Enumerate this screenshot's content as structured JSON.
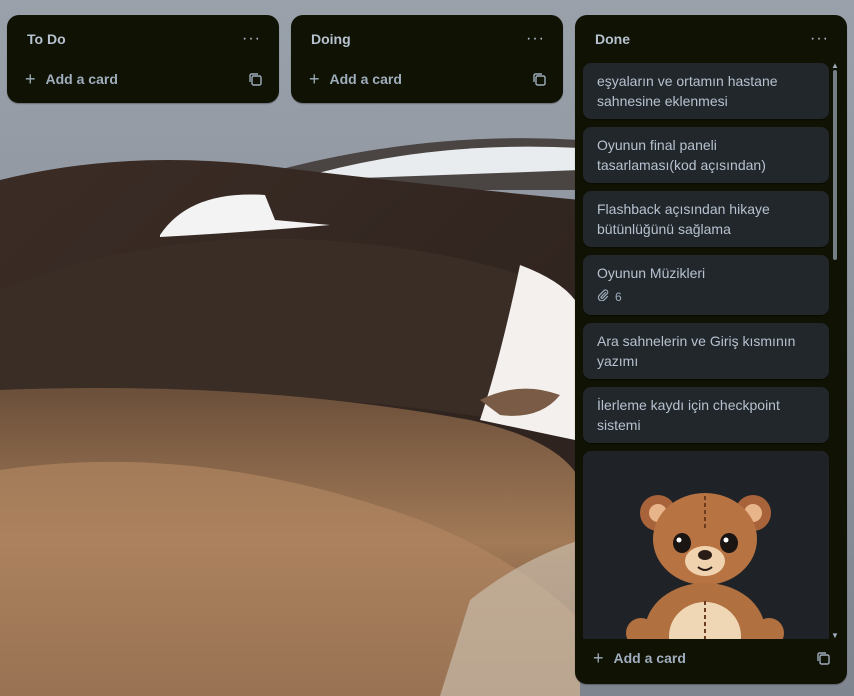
{
  "lists": [
    {
      "title": "To Do",
      "menu": "···",
      "add_label": "Add a card"
    },
    {
      "title": "Doing",
      "menu": "···",
      "add_label": "Add a card"
    },
    {
      "title": "Done",
      "menu": "···",
      "add_label": "Add a card",
      "cards": [
        {
          "title": "eşyaların ve ortamın hastane sahnesine eklenmesi"
        },
        {
          "title": "Oyunun final paneli tasarlaması(kod açısından)"
        },
        {
          "title": "Flashback açısından hikaye bütünlüğünü sağlama"
        },
        {
          "title": "Oyunun Müzikleri",
          "attachments": "6"
        },
        {
          "title": "Ara sahnelerin ve Giriş kısmının yazımı"
        },
        {
          "title": "İlerleme kaydı için checkpoint sistemi"
        }
      ]
    }
  ],
  "icons": {
    "plus": "plus-icon",
    "template": "card-template-icon",
    "attachment": "paperclip-icon",
    "menu": "more-dots-icon"
  },
  "colors": {
    "list_bg": "#101204",
    "card_bg": "#22272b",
    "text": "#b6c2cf"
  }
}
